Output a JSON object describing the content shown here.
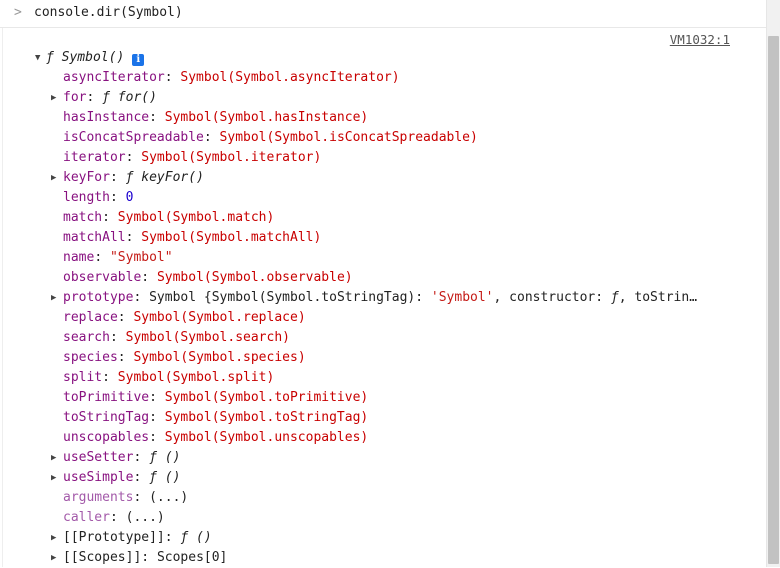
{
  "console": {
    "prompt_glyph": ">",
    "command": "console.dir(Symbol)",
    "source_link": "VM1032:1"
  },
  "root": {
    "expanded_glyph": "▼",
    "f_glyph": "ƒ",
    "label": "Symbol()",
    "info_glyph": "i"
  },
  "rows": [
    {
      "name": "asyncIterator-row",
      "expandable": false,
      "key": "asyncIterator",
      "value": "Symbol(Symbol.asyncIterator)",
      "kind": "sym"
    },
    {
      "name": "for-row",
      "expandable": true,
      "key": "for",
      "value": "ƒ for()",
      "kind": "fn"
    },
    {
      "name": "hasInstance-row",
      "expandable": false,
      "key": "hasInstance",
      "value": "Symbol(Symbol.hasInstance)",
      "kind": "sym"
    },
    {
      "name": "isConcatSpreadable-row",
      "expandable": false,
      "key": "isConcatSpreadable",
      "value": "Symbol(Symbol.isConcatSpreadable)",
      "kind": "sym"
    },
    {
      "name": "iterator-row",
      "expandable": false,
      "key": "iterator",
      "value": "Symbol(Symbol.iterator)",
      "kind": "sym"
    },
    {
      "name": "keyFor-row",
      "expandable": true,
      "key": "keyFor",
      "value": "ƒ keyFor()",
      "kind": "fn"
    },
    {
      "name": "length-row",
      "expandable": false,
      "key": "length",
      "value": "0",
      "kind": "num"
    },
    {
      "name": "match-row",
      "expandable": false,
      "key": "match",
      "value": "Symbol(Symbol.match)",
      "kind": "sym"
    },
    {
      "name": "matchAll-row",
      "expandable": false,
      "key": "matchAll",
      "value": "Symbol(Symbol.matchAll)",
      "kind": "sym"
    },
    {
      "name": "name-row",
      "expandable": false,
      "key": "name",
      "value": "\"Symbol\"",
      "kind": "str"
    },
    {
      "name": "observable-row",
      "expandable": false,
      "key": "observable",
      "value": "Symbol(Symbol.observable)",
      "kind": "sym"
    },
    {
      "name": "prototype-row",
      "expandable": true,
      "key": "prototype",
      "value": "",
      "kind": "proto",
      "parts": [
        {
          "t": "Symbol {",
          "c": "plain"
        },
        {
          "t": "Symbol(Symbol.toStringTag)",
          "c": "plain"
        },
        {
          "t": ": ",
          "c": "plain"
        },
        {
          "t": "'Symbol'",
          "c": "str"
        },
        {
          "t": ", constructor: ",
          "c": "plain"
        },
        {
          "t": "ƒ",
          "c": "fnval"
        },
        {
          "t": ", toStrin…",
          "c": "plain"
        }
      ]
    },
    {
      "name": "replace-row",
      "expandable": false,
      "key": "replace",
      "value": "Symbol(Symbol.replace)",
      "kind": "sym"
    },
    {
      "name": "search-row",
      "expandable": false,
      "key": "search",
      "value": "Symbol(Symbol.search)",
      "kind": "sym"
    },
    {
      "name": "species-row",
      "expandable": false,
      "key": "species",
      "value": "Symbol(Symbol.species)",
      "kind": "sym"
    },
    {
      "name": "split-row",
      "expandable": false,
      "key": "split",
      "value": "Symbol(Symbol.split)",
      "kind": "sym"
    },
    {
      "name": "toPrimitive-row",
      "expandable": false,
      "key": "toPrimitive",
      "value": "Symbol(Symbol.toPrimitive)",
      "kind": "sym"
    },
    {
      "name": "toStringTag-row",
      "expandable": false,
      "key": "toStringTag",
      "value": "Symbol(Symbol.toStringTag)",
      "kind": "sym"
    },
    {
      "name": "unscopables-row",
      "expandable": false,
      "key": "unscopables",
      "value": "Symbol(Symbol.unscopables)",
      "kind": "sym"
    },
    {
      "name": "useSetter-row",
      "expandable": true,
      "key": "useSetter",
      "value": "ƒ ()",
      "kind": "fn"
    },
    {
      "name": "useSimple-row",
      "expandable": true,
      "key": "useSimple",
      "value": "ƒ ()",
      "kind": "fn"
    },
    {
      "name": "arguments-row",
      "expandable": false,
      "key": "arguments",
      "value": "(...)",
      "kind": "lazy",
      "muted": true
    },
    {
      "name": "caller-row",
      "expandable": false,
      "key": "caller",
      "value": "(...)",
      "kind": "lazy",
      "muted": true
    },
    {
      "name": "internal-prototype-row",
      "expandable": true,
      "key": "[[Prototype]]",
      "value": "ƒ ()",
      "kind": "fn",
      "plainkey": true
    },
    {
      "name": "internal-scopes-row",
      "expandable": true,
      "key": "[[Scopes]]",
      "value": "Scopes[0]",
      "kind": "plain",
      "plainkey": true
    }
  ],
  "collapsed_glyph": "▶",
  "key_separator": ": ",
  "colors": {
    "key": "#881280",
    "symbol": "#c80000",
    "string": "#c41a16",
    "number": "#1c00cf",
    "info_badge": "#1a73e8"
  }
}
